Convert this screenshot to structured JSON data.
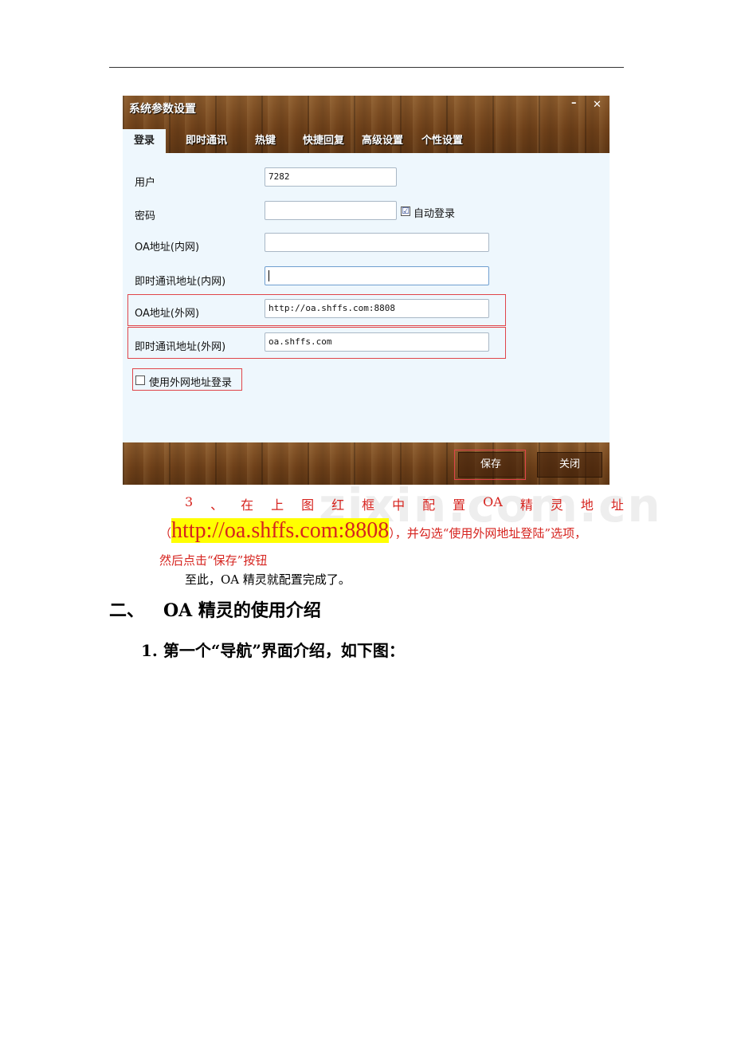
{
  "dialog": {
    "title": "系统参数设置",
    "min_symbol": "–",
    "close_symbol": "✕",
    "tabs": [
      "登录",
      "即时通讯",
      "热键",
      "快捷回复",
      "高级设置",
      "个性设置"
    ],
    "fields": {
      "user_label": "用户",
      "user_value": "7282",
      "password_label": "密码",
      "password_value": "",
      "auto_login_label": "自动登录",
      "auto_login_checked": "☑",
      "oa_internal_label": "OA地址(内网)",
      "oa_internal_value": "",
      "im_internal_label": "即时通讯地址(内网)",
      "im_internal_value": "",
      "oa_external_label": "OA地址(外网)",
      "oa_external_value": "http://oa.shffs.com:8808",
      "im_external_label": "即时通讯地址(外网)",
      "im_external_value": "oa.shffs.com",
      "use_external_label": "使用外网地址登录"
    },
    "buttons": {
      "save": "保存",
      "close": "关闭"
    }
  },
  "caption": {
    "line1_words": [
      "3",
      "、",
      "在",
      "上",
      "图",
      "红",
      "框",
      "中",
      "配",
      "置",
      "OA",
      "精",
      "灵",
      "地",
      "址"
    ],
    "paren_open": "（",
    "url": "http://oa.shffs.com:8808",
    "line2_rest": "），并勾选“使用外网地址登陆”选项，",
    "line3": "然后点击“保存”按钮",
    "line4": "至此，OA 精灵就配置完成了。"
  },
  "section": {
    "number": "二、",
    "title": "OA 精灵的使用介绍"
  },
  "subsection": {
    "text": "1.  第一个“导航”界面介绍，如下图："
  },
  "watermark": "zixin.com.cn",
  "colors": {
    "accent_red": "#d6241f",
    "highlight": "#ffff00",
    "panel_bg": "#eef7fd"
  }
}
